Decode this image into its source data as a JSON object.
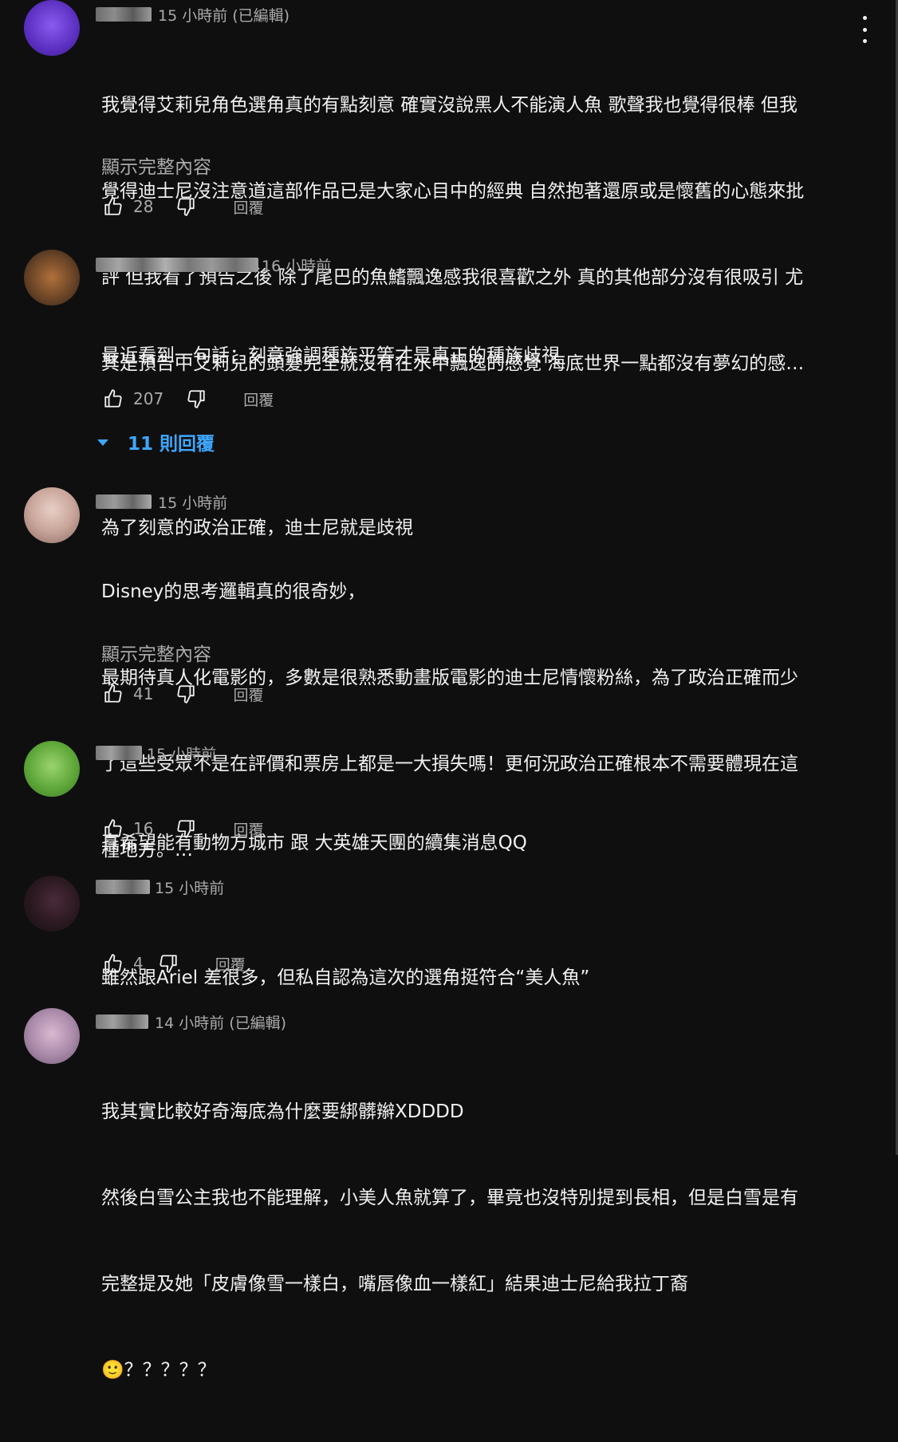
{
  "comments": [
    {
      "time": "15 小時前 (已編輯)",
      "lines": [
        "我覺得艾莉兒角色選角真的有點刻意 確實沒說黑人不能演人魚 歌聲我也覺得很棒 但我",
        "覺得迪士尼沒注意道這部作品已是大家心目中的經典 自然抱著還原或是懷舊的心態來批",
        "評 但我看了預告之後 除了尾巴的魚鰭飄逸感我很喜歡之外 真的其他部分沒有很吸引 尤",
        "其是預告中艾莉兒的頭髮完全就沒有在水中飄逸的感覺 海底世界一點都沒有夢幻的感…"
      ],
      "show_more": "顯示完整內容",
      "likes": "28",
      "reply": "回覆"
    },
    {
      "time": "16 小時前",
      "lines": [
        "最近看到一句話：刻意強調種族平等才是真正的種族歧視",
        "",
        "為了刻意的政治正確，迪士尼就是歧視"
      ],
      "likes": "207",
      "reply": "回覆",
      "replies_toggle": "11 則回覆"
    },
    {
      "time": "15 小時前",
      "lines": [
        "Disney的思考邏輯真的很奇妙，",
        "最期待真人化電影的，多數是很熟悉動畫版電影的迪士尼情懷粉絲，為了政治正確而少",
        "了這些受眾不是在評價和票房上都是一大損失嗎！更何況政治正確根本不需要體現在這",
        "種地方。…"
      ],
      "show_more": "顯示完整內容",
      "likes": "41",
      "reply": "回覆"
    },
    {
      "time": "15 小時前",
      "lines": [
        "真希望能有動物方城市 跟 大英雄天團的續集消息QQ"
      ],
      "likes": "16",
      "reply": "回覆"
    },
    {
      "time": "15 小時前",
      "lines": [
        "雖然跟Ariel 差很多，但私自認為這次的選角挺符合“美人魚”"
      ],
      "likes": "4",
      "reply": "回覆"
    },
    {
      "time": "14 小時前 (已編輯)",
      "lines": [
        "我其實比較好奇海底為什麼要綁髒辮XDDDD",
        "然後白雪公主我也不能理解，小美人魚就算了，畢竟也沒特別提到長相，但是白雪是有",
        "完整提及她「皮膚像雪一樣白，嘴唇像血一樣紅」結果迪士尼給我拉丁裔",
        "🙂？？？？？"
      ]
    }
  ],
  "colors": {
    "background": "#0f0f0f",
    "text": "#f1f1f1",
    "secondary": "#aaaaaa",
    "link": "#3ea6ff"
  },
  "icons": [
    "like-icon",
    "dislike-icon",
    "more-vert-icon",
    "caret-down-icon"
  ]
}
